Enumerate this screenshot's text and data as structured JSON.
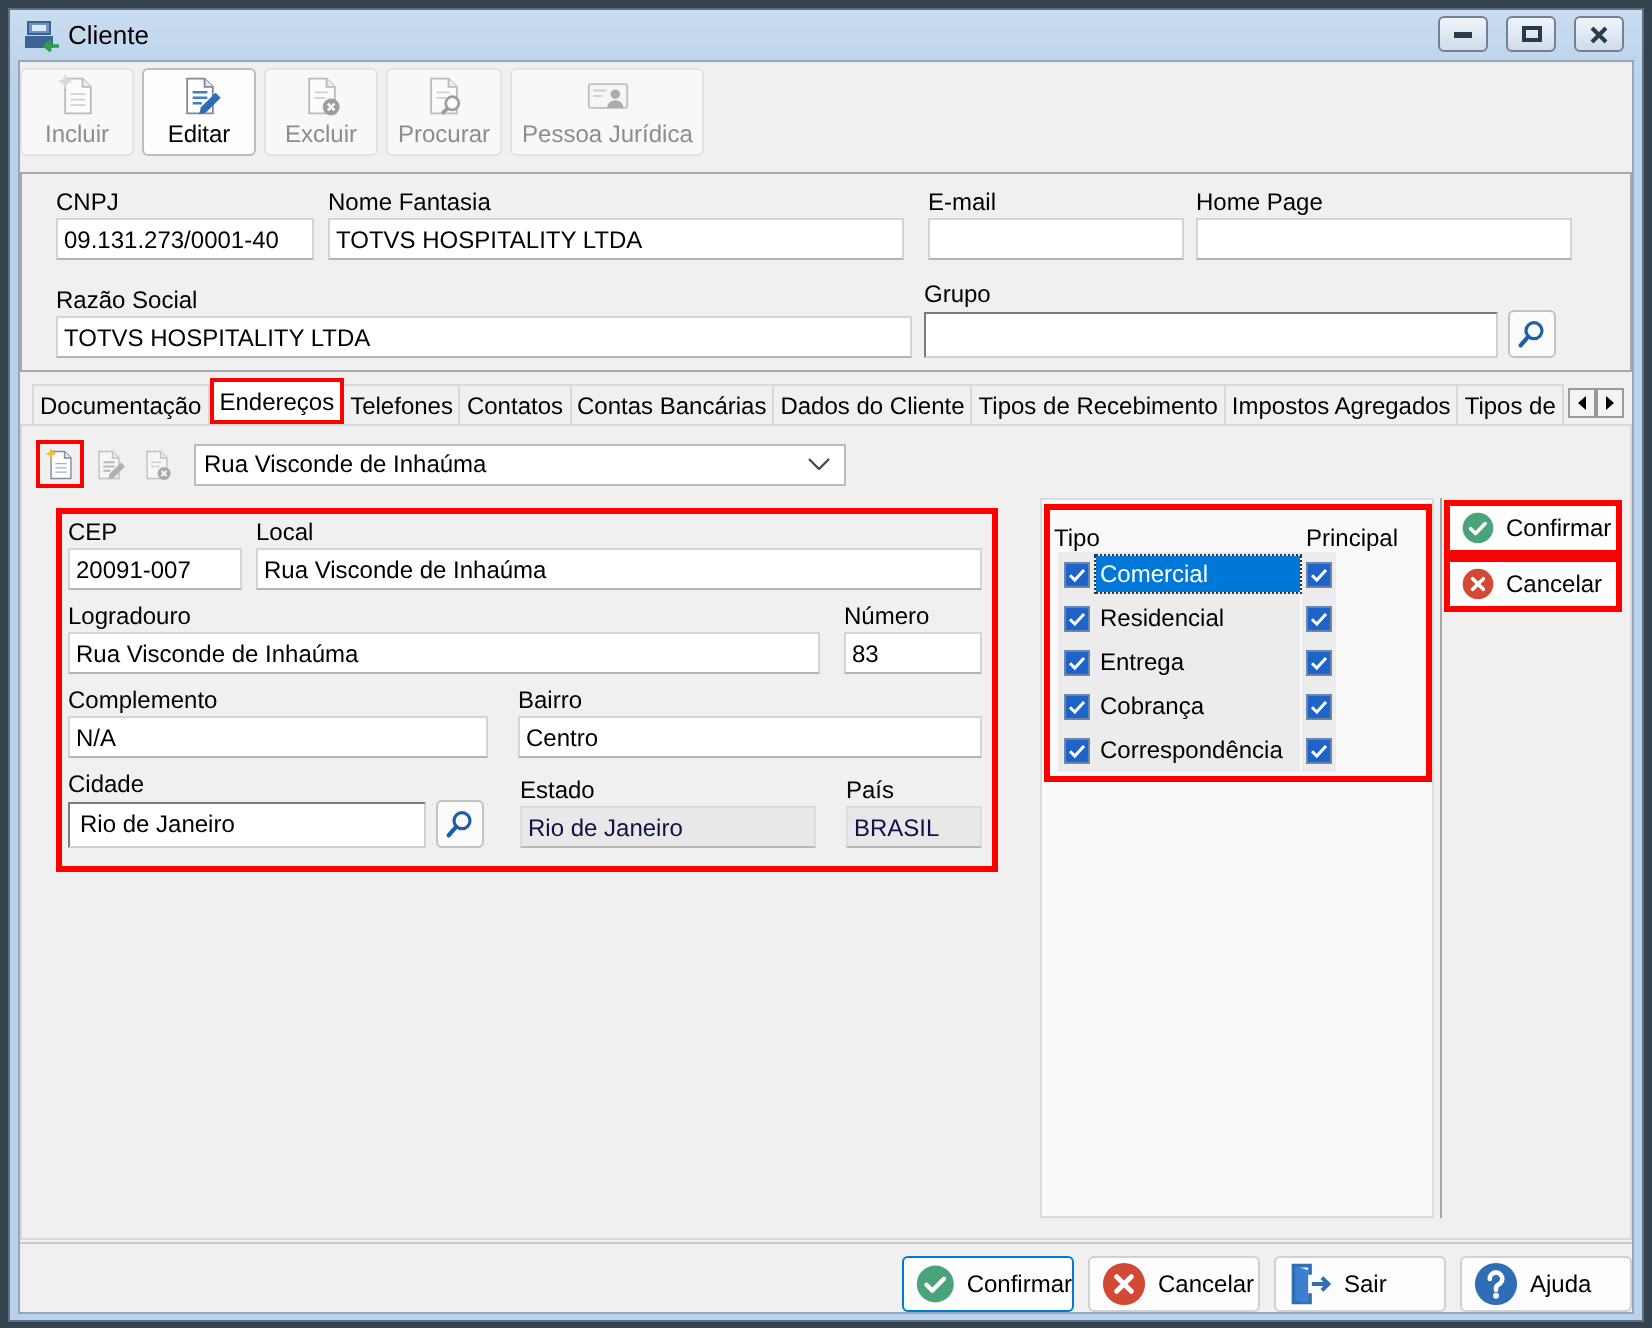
{
  "window": {
    "title": "Cliente"
  },
  "toolbar": [
    {
      "kind": "new",
      "label": "Incluir",
      "disabled": true
    },
    {
      "kind": "edit",
      "label": "Editar",
      "disabled": false
    },
    {
      "kind": "delete",
      "label": "Excluir",
      "disabled": true
    },
    {
      "kind": "search",
      "label": "Procurar",
      "disabled": true
    },
    {
      "kind": "card",
      "label": "Pessoa Jurídica",
      "disabled": true
    }
  ],
  "header": {
    "fields": [
      {
        "kind": "text",
        "label": "CNPJ",
        "value": "09.131.273/0001-40"
      },
      {
        "kind": "text",
        "label": "Nome Fantasia",
        "value": "TOTVS HOSPITALITY LTDA"
      },
      {
        "kind": "text",
        "label": "E-mail"
      },
      {
        "kind": "text",
        "label": "Home Page"
      },
      {
        "kind": "text",
        "label": "Razão Social",
        "value": "TOTVS HOSPITALITY LTDA"
      },
      {
        "kind": "lookup",
        "label": "Grupo"
      }
    ]
  },
  "tabs": [
    {
      "label": "Documentação",
      "selected": false,
      "highlighted": false
    },
    {
      "label": "Endereços",
      "selected": true,
      "highlighted": true
    },
    {
      "label": "Telefones",
      "selected": false,
      "highlighted": false
    },
    {
      "label": "Contatos",
      "selected": false,
      "highlighted": false
    },
    {
      "label": "Contas Bancárias",
      "selected": false,
      "highlighted": false
    },
    {
      "label": "Dados do Cliente",
      "selected": false,
      "highlighted": false
    },
    {
      "label": "Tipos de Recebimento",
      "selected": false,
      "highlighted": false
    },
    {
      "label": "Impostos Agregados",
      "selected": false,
      "highlighted": false
    },
    {
      "label": "Tipos de",
      "selected": false,
      "highlighted": false
    }
  ],
  "address_bar": {
    "buttons": [
      {
        "kind": "new",
        "disabled": false,
        "highlighted": true
      },
      {
        "kind": "edit",
        "disabled": true,
        "highlighted": false
      },
      {
        "kind": "delete",
        "disabled": true,
        "highlighted": false
      }
    ],
    "select": {
      "value": "Rua Visconde de Inhaúma"
    }
  },
  "address_form": {
    "highlighted": true,
    "fields": [
      {
        "kind": "text",
        "label": "CEP",
        "value": "20091-007",
        "read_only": false
      },
      {
        "kind": "text",
        "label": "Local",
        "value": "Rua Visconde de Inhaúma",
        "read_only": false
      },
      {
        "kind": "text",
        "label": "Logradouro",
        "value": "Rua Visconde de Inhaúma",
        "read_only": false
      },
      {
        "kind": "text",
        "label": "Número",
        "value": "83",
        "read_only": false
      },
      {
        "kind": "text",
        "label": "Complemento",
        "value": "N/A",
        "read_only": false
      },
      {
        "kind": "text",
        "label": "Bairro",
        "value": "Centro",
        "read_only": false
      },
      {
        "kind": "lookup",
        "label": "Cidade",
        "value": "Rio de Janeiro",
        "read_only": false
      },
      {
        "kind": "text",
        "label": "Estado",
        "value": "Rio de Janeiro",
        "read_only": true
      },
      {
        "kind": "text",
        "label": "País",
        "value": "BRASIL",
        "read_only": true
      }
    ]
  },
  "tipo_panel": {
    "highlighted": true,
    "type_header": "Tipo",
    "principal_header": "Principal",
    "items": [
      {
        "label": "Comercial",
        "checked": true,
        "principal": true,
        "selected": true
      },
      {
        "label": "Residencial",
        "checked": true,
        "principal": true,
        "selected": false
      },
      {
        "label": "Entrega",
        "checked": true,
        "principal": true,
        "selected": false
      },
      {
        "label": "Cobrança",
        "checked": true,
        "principal": true,
        "selected": false
      },
      {
        "label": "Correspondência",
        "checked": true,
        "principal": true,
        "selected": false
      }
    ]
  },
  "side_buttons": [
    {
      "kind": "confirm",
      "label": "Confirmar",
      "highlighted": true
    },
    {
      "kind": "cancel",
      "label": "Cancelar",
      "highlighted": true
    }
  ],
  "footer_buttons": [
    {
      "kind": "confirm",
      "label": "Confirmar",
      "focused": true
    },
    {
      "kind": "cancel",
      "label": "Cancelar",
      "focused": false
    },
    {
      "kind": "exit",
      "label": "Sair",
      "focused": false
    },
    {
      "kind": "help",
      "label": "Ajuda",
      "focused": false
    }
  ]
}
